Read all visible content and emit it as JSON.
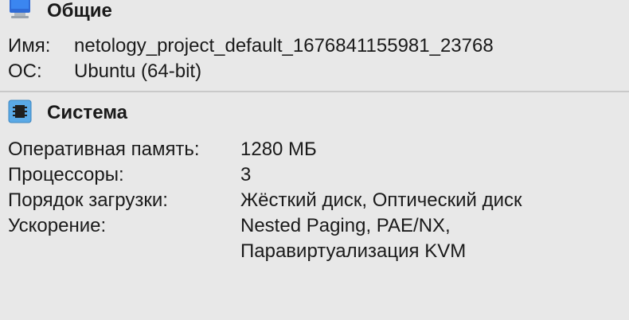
{
  "general": {
    "title": "Общие",
    "icon": "monitor-icon",
    "rows": [
      {
        "label": "Имя:",
        "value": "netology_project_default_1676841155981_23768"
      },
      {
        "label": "ОС:",
        "value": "Ubuntu (64-bit)"
      }
    ]
  },
  "system": {
    "title": "Система",
    "icon": "chip-icon",
    "rows": [
      {
        "label": "Оперативная память:",
        "value": "1280 МБ"
      },
      {
        "label": "Процессоры:",
        "value": "3"
      },
      {
        "label": "Порядок загрузки:",
        "value": "Жёсткий диск, Оптический диск"
      },
      {
        "label": "Ускорение:",
        "value": "Nested Paging, PAE/NX,"
      },
      {
        "label": "",
        "value": "Паравиртуализация KVM"
      }
    ]
  },
  "colors": {
    "background": "#e8e8e8",
    "monitor_blue": "#2f6bd6",
    "chip_blue": "#5aa9e6"
  }
}
